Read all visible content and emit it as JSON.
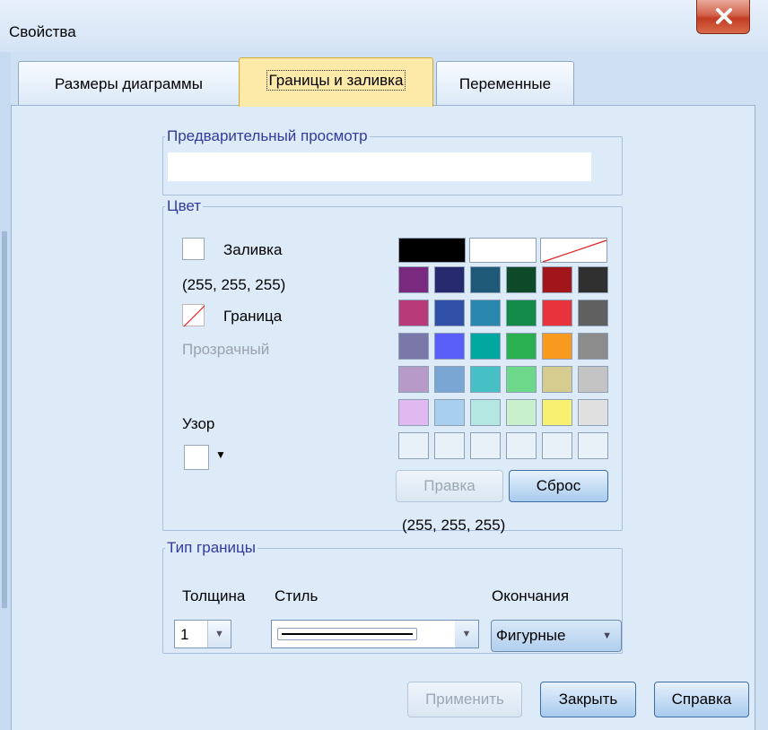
{
  "window": {
    "title": "Свойства"
  },
  "tabs": [
    {
      "label": "Размеры диаграммы"
    },
    {
      "label": "Границы и заливка"
    },
    {
      "label": "Переменные"
    }
  ],
  "preview": {
    "legend": "Предварительный просмотр"
  },
  "color": {
    "legend": "Цвет",
    "fill_label": "Заливка",
    "fill_value": "(255, 255, 255)",
    "border_label": "Граница",
    "border_value": "Прозрачный",
    "pattern_label": "Узор",
    "edit_button": "Правка",
    "reset_button": "Сброс",
    "selected_value": "(255, 255, 255)",
    "top_row": [
      "#000000",
      "#ffffff",
      "transparent"
    ],
    "palette": [
      [
        "#7a2a7e",
        "#262a6e",
        "#1e5a78",
        "#0e4a2a",
        "#a2151a",
        "#303030"
      ],
      [
        "#b93a78",
        "#3050a8",
        "#2a88b0",
        "#138a48",
        "#e8323c",
        "#606060"
      ],
      [
        "#7a78a8",
        "#5a5ef8",
        "#00a8a0",
        "#2ab050",
        "#f89a1e",
        "#8c8c8c"
      ],
      [
        "#b89ac8",
        "#7aa6d4",
        "#46c0c4",
        "#6ed88a",
        "#d6cc90",
        "#c4c4c4"
      ],
      [
        "#e2b8f0",
        "#a8d0ee",
        "#b4e6e2",
        "#c8f0cc",
        "#f8f070",
        "#e0e0e0"
      ],
      [
        "#e8f0f8",
        "#e8f0f8",
        "#e8f0f8",
        "#e8f0f8",
        "#e8f0f8",
        "#e8f0f8"
      ]
    ]
  },
  "border_type": {
    "legend": "Тип границы",
    "thickness_label": "Толщина",
    "thickness_value": "1",
    "style_label": "Стиль",
    "endings_label": "Окончания",
    "endings_value": "Фигурные"
  },
  "footer": {
    "apply_button": "Применить",
    "close_button": "Закрыть",
    "help_button": "Справка"
  }
}
